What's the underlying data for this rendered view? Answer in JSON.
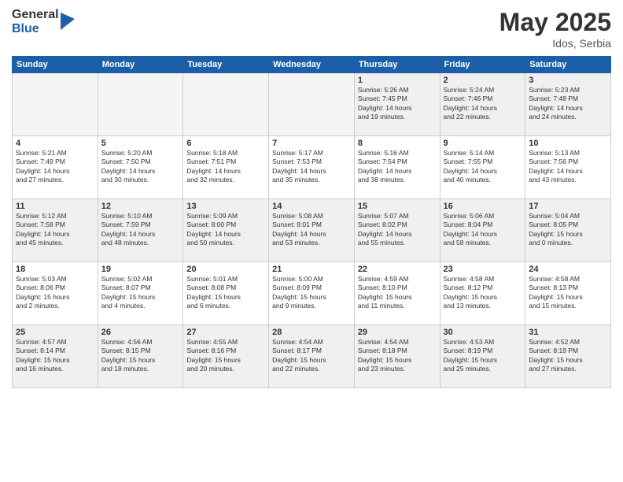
{
  "header": {
    "logo_general": "General",
    "logo_blue": "Blue",
    "title": "May 2025",
    "location": "Idos, Serbia"
  },
  "weekdays": [
    "Sunday",
    "Monday",
    "Tuesday",
    "Wednesday",
    "Thursday",
    "Friday",
    "Saturday"
  ],
  "weeks": [
    [
      {
        "day": "",
        "info": "",
        "empty": true
      },
      {
        "day": "",
        "info": "",
        "empty": true
      },
      {
        "day": "",
        "info": "",
        "empty": true
      },
      {
        "day": "",
        "info": "",
        "empty": true
      },
      {
        "day": "1",
        "info": "Sunrise: 5:26 AM\nSunset: 7:45 PM\nDaylight: 14 hours\nand 19 minutes."
      },
      {
        "day": "2",
        "info": "Sunrise: 5:24 AM\nSunset: 7:46 PM\nDaylight: 14 hours\nand 22 minutes."
      },
      {
        "day": "3",
        "info": "Sunrise: 5:23 AM\nSunset: 7:48 PM\nDaylight: 14 hours\nand 24 minutes."
      }
    ],
    [
      {
        "day": "4",
        "info": "Sunrise: 5:21 AM\nSunset: 7:49 PM\nDaylight: 14 hours\nand 27 minutes."
      },
      {
        "day": "5",
        "info": "Sunrise: 5:20 AM\nSunset: 7:50 PM\nDaylight: 14 hours\nand 30 minutes."
      },
      {
        "day": "6",
        "info": "Sunrise: 5:18 AM\nSunset: 7:51 PM\nDaylight: 14 hours\nand 32 minutes."
      },
      {
        "day": "7",
        "info": "Sunrise: 5:17 AM\nSunset: 7:53 PM\nDaylight: 14 hours\nand 35 minutes."
      },
      {
        "day": "8",
        "info": "Sunrise: 5:16 AM\nSunset: 7:54 PM\nDaylight: 14 hours\nand 38 minutes."
      },
      {
        "day": "9",
        "info": "Sunrise: 5:14 AM\nSunset: 7:55 PM\nDaylight: 14 hours\nand 40 minutes."
      },
      {
        "day": "10",
        "info": "Sunrise: 5:13 AM\nSunset: 7:56 PM\nDaylight: 14 hours\nand 43 minutes."
      }
    ],
    [
      {
        "day": "11",
        "info": "Sunrise: 5:12 AM\nSunset: 7:58 PM\nDaylight: 14 hours\nand 45 minutes."
      },
      {
        "day": "12",
        "info": "Sunrise: 5:10 AM\nSunset: 7:59 PM\nDaylight: 14 hours\nand 48 minutes."
      },
      {
        "day": "13",
        "info": "Sunrise: 5:09 AM\nSunset: 8:00 PM\nDaylight: 14 hours\nand 50 minutes."
      },
      {
        "day": "14",
        "info": "Sunrise: 5:08 AM\nSunset: 8:01 PM\nDaylight: 14 hours\nand 53 minutes."
      },
      {
        "day": "15",
        "info": "Sunrise: 5:07 AM\nSunset: 8:02 PM\nDaylight: 14 hours\nand 55 minutes."
      },
      {
        "day": "16",
        "info": "Sunrise: 5:06 AM\nSunset: 8:04 PM\nDaylight: 14 hours\nand 58 minutes."
      },
      {
        "day": "17",
        "info": "Sunrise: 5:04 AM\nSunset: 8:05 PM\nDaylight: 15 hours\nand 0 minutes."
      }
    ],
    [
      {
        "day": "18",
        "info": "Sunrise: 5:03 AM\nSunset: 8:06 PM\nDaylight: 15 hours\nand 2 minutes."
      },
      {
        "day": "19",
        "info": "Sunrise: 5:02 AM\nSunset: 8:07 PM\nDaylight: 15 hours\nand 4 minutes."
      },
      {
        "day": "20",
        "info": "Sunrise: 5:01 AM\nSunset: 8:08 PM\nDaylight: 15 hours\nand 6 minutes."
      },
      {
        "day": "21",
        "info": "Sunrise: 5:00 AM\nSunset: 8:09 PM\nDaylight: 15 hours\nand 9 minutes."
      },
      {
        "day": "22",
        "info": "Sunrise: 4:59 AM\nSunset: 8:10 PM\nDaylight: 15 hours\nand 11 minutes."
      },
      {
        "day": "23",
        "info": "Sunrise: 4:58 AM\nSunset: 8:12 PM\nDaylight: 15 hours\nand 13 minutes."
      },
      {
        "day": "24",
        "info": "Sunrise: 4:58 AM\nSunset: 8:13 PM\nDaylight: 15 hours\nand 15 minutes."
      }
    ],
    [
      {
        "day": "25",
        "info": "Sunrise: 4:57 AM\nSunset: 8:14 PM\nDaylight: 15 hours\nand 16 minutes."
      },
      {
        "day": "26",
        "info": "Sunrise: 4:56 AM\nSunset: 8:15 PM\nDaylight: 15 hours\nand 18 minutes."
      },
      {
        "day": "27",
        "info": "Sunrise: 4:55 AM\nSunset: 8:16 PM\nDaylight: 15 hours\nand 20 minutes."
      },
      {
        "day": "28",
        "info": "Sunrise: 4:54 AM\nSunset: 8:17 PM\nDaylight: 15 hours\nand 22 minutes."
      },
      {
        "day": "29",
        "info": "Sunrise: 4:54 AM\nSunset: 8:18 PM\nDaylight: 15 hours\nand 23 minutes."
      },
      {
        "day": "30",
        "info": "Sunrise: 4:53 AM\nSunset: 8:19 PM\nDaylight: 15 hours\nand 25 minutes."
      },
      {
        "day": "31",
        "info": "Sunrise: 4:52 AM\nSunset: 8:19 PM\nDaylight: 15 hours\nand 27 minutes."
      }
    ]
  ]
}
